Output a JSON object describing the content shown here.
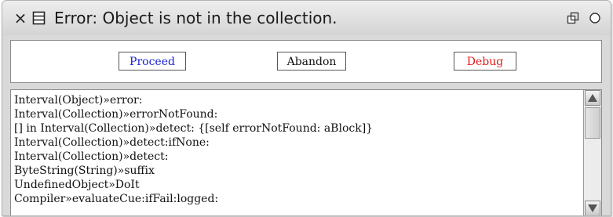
{
  "window": {
    "title": "Error: Object is not in the collection.",
    "icons": {
      "close": "close-icon",
      "menu": "window-menu-icon",
      "collapse": "collapse-icon",
      "expand": "expand-icon"
    },
    "close_glyph": "×"
  },
  "buttons": {
    "proceed": "Proceed",
    "abandon": "Abandon",
    "debug": "Debug",
    "colors": {
      "proceed": "#1a22d8",
      "abandon": "#111111",
      "debug": "#e01818"
    }
  },
  "stack": {
    "items": [
      "Interval(Object)»error:",
      "Interval(Collection)»errorNotFound:",
      "[] in Interval(Collection)»detect: {[self errorNotFound: aBlock]}",
      "Interval(Collection)»detect:ifNone:",
      "Interval(Collection)»detect:",
      "ByteString(String)»suffix",
      "UndefinedObject»DoIt",
      "Compiler»evaluateCue:ifFail:logged:"
    ]
  }
}
